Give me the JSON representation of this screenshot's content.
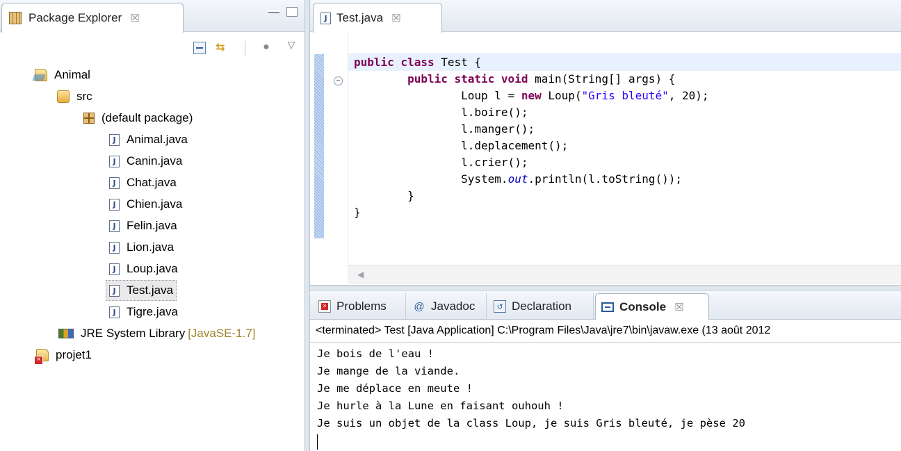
{
  "package_explorer": {
    "tab_label": "Package Explorer",
    "tab_close": "☒",
    "tree": [
      {
        "label": "Animal",
        "extra": ""
      },
      {
        "label": "src",
        "extra": ""
      },
      {
        "label": "(default package)",
        "extra": ""
      },
      {
        "label": "Animal.java",
        "extra": ""
      },
      {
        "label": "Canin.java",
        "extra": ""
      },
      {
        "label": "Chat.java",
        "extra": ""
      },
      {
        "label": "Chien.java",
        "extra": ""
      },
      {
        "label": "Felin.java",
        "extra": ""
      },
      {
        "label": "Lion.java",
        "extra": ""
      },
      {
        "label": "Loup.java",
        "extra": ""
      },
      {
        "label": "Test.java",
        "extra": ""
      },
      {
        "label": "Tigre.java",
        "extra": ""
      },
      {
        "label": "JRE System Library",
        "extra": "[JavaSE-1.7]"
      },
      {
        "label": "projet1",
        "extra": ""
      }
    ]
  },
  "editor": {
    "tab_label": "Test.java",
    "tab_close": "☒",
    "code": {
      "l1_kw": "public class",
      "l1_rest": " Test {",
      "l2_indent": "        ",
      "l2_kw": "public static void",
      "l2_rest": " main(String[] args) {",
      "l3_pre": "                Loup l = ",
      "l3_kw": "new",
      "l3_mid": " Loup(",
      "l3_str": "\"Gris bleuté\"",
      "l3_end": ", 20);",
      "l4": "                l.boire();",
      "l5": "                l.manger();",
      "l6": "                l.deplacement();",
      "l7": "                l.crier();",
      "l8_pre": "                System.",
      "l8_field": "out",
      "l8_end": ".println(l.toString());",
      "l9": "        }",
      "l10": "}"
    }
  },
  "bottom": {
    "tabs": {
      "problems": "Problems",
      "javadoc": "Javadoc",
      "declaration": "Declaration",
      "console": "Console"
    },
    "javadoc_icon": "@",
    "console_close": "☒",
    "description": "<terminated> Test [Java Application] C:\\Program Files\\Java\\jre7\\bin\\javaw.exe (13 août 2012",
    "output": [
      "Je bois de l'eau !",
      "Je mange de la viande.",
      "Je me déplace en meute !",
      "Je hurle à la Lune en faisant ouhouh !",
      "Je suis un objet de la class Loup, je suis Gris bleuté, je pèse 20"
    ]
  },
  "colors": {
    "keyword": "#7f0055",
    "string": "#2a00ff",
    "static_field": "#0000c0",
    "current_line": "#e8f2fe"
  }
}
